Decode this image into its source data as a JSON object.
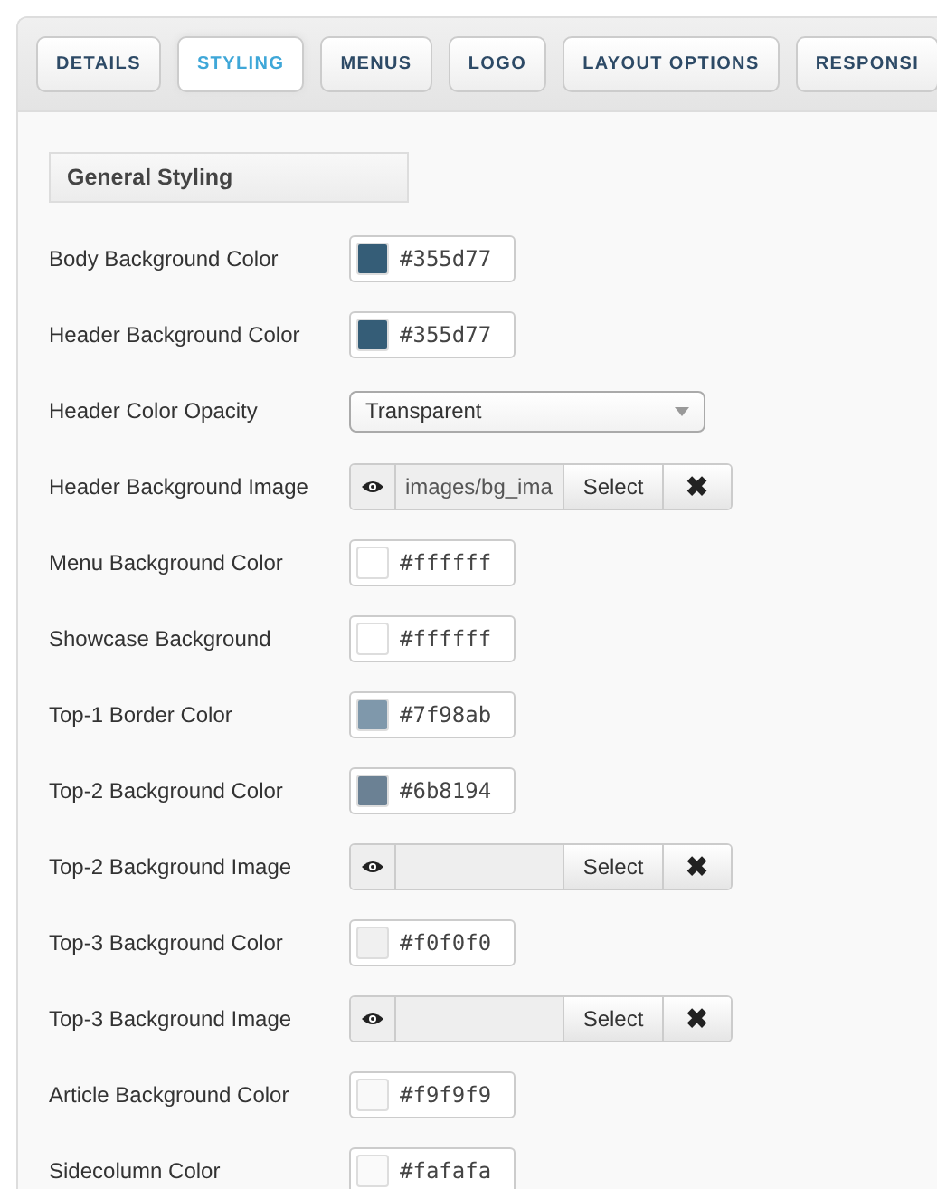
{
  "tabs": [
    {
      "label": "DETAILS",
      "selected": false
    },
    {
      "label": "STYLING",
      "selected": true
    },
    {
      "label": "MENUS",
      "selected": false
    },
    {
      "label": "LOGO",
      "selected": false
    },
    {
      "label": "LAYOUT OPTIONS",
      "selected": false
    },
    {
      "label": "RESPONSI",
      "selected": false
    }
  ],
  "section_title": "General Styling",
  "rows": [
    {
      "kind": "color",
      "label": "Body Background Color",
      "value": "#355d77",
      "color": "#355d77"
    },
    {
      "kind": "color",
      "label": "Header Background Color",
      "value": "#355d77",
      "color": "#355d77"
    },
    {
      "kind": "select",
      "label": "Header Color Opacity",
      "value": "Transparent"
    },
    {
      "kind": "image",
      "label": "Header Background Image",
      "value": "images/bg_ima",
      "button": "Select",
      "clear": "✖"
    },
    {
      "kind": "color",
      "label": "Menu Background Color",
      "value": "#ffffff",
      "color": "#ffffff"
    },
    {
      "kind": "color",
      "label": "Showcase Background",
      "value": "#ffffff",
      "color": "#ffffff"
    },
    {
      "kind": "color",
      "label": "Top-1 Border Color",
      "value": "#7f98ab",
      "color": "#7f98ab"
    },
    {
      "kind": "color",
      "label": "Top-2 Background Color",
      "value": "#6b8194",
      "color": "#6b8194"
    },
    {
      "kind": "image",
      "label": "Top-2 Background Image",
      "button": "Select",
      "clear": "✖"
    },
    {
      "kind": "color",
      "label": "Top-3 Background Color",
      "value": "#f0f0f0",
      "color": "#f0f0f0"
    },
    {
      "kind": "image",
      "label": "Top-3 Background Image",
      "button": "Select",
      "clear": "✖"
    },
    {
      "kind": "color",
      "label": "Article Background Color",
      "value": "#f9f9f9",
      "color": "#f9f9f9"
    },
    {
      "kind": "color",
      "label": "Sidecolumn Color",
      "value": "#fafafa",
      "color": "#fafafa"
    }
  ]
}
